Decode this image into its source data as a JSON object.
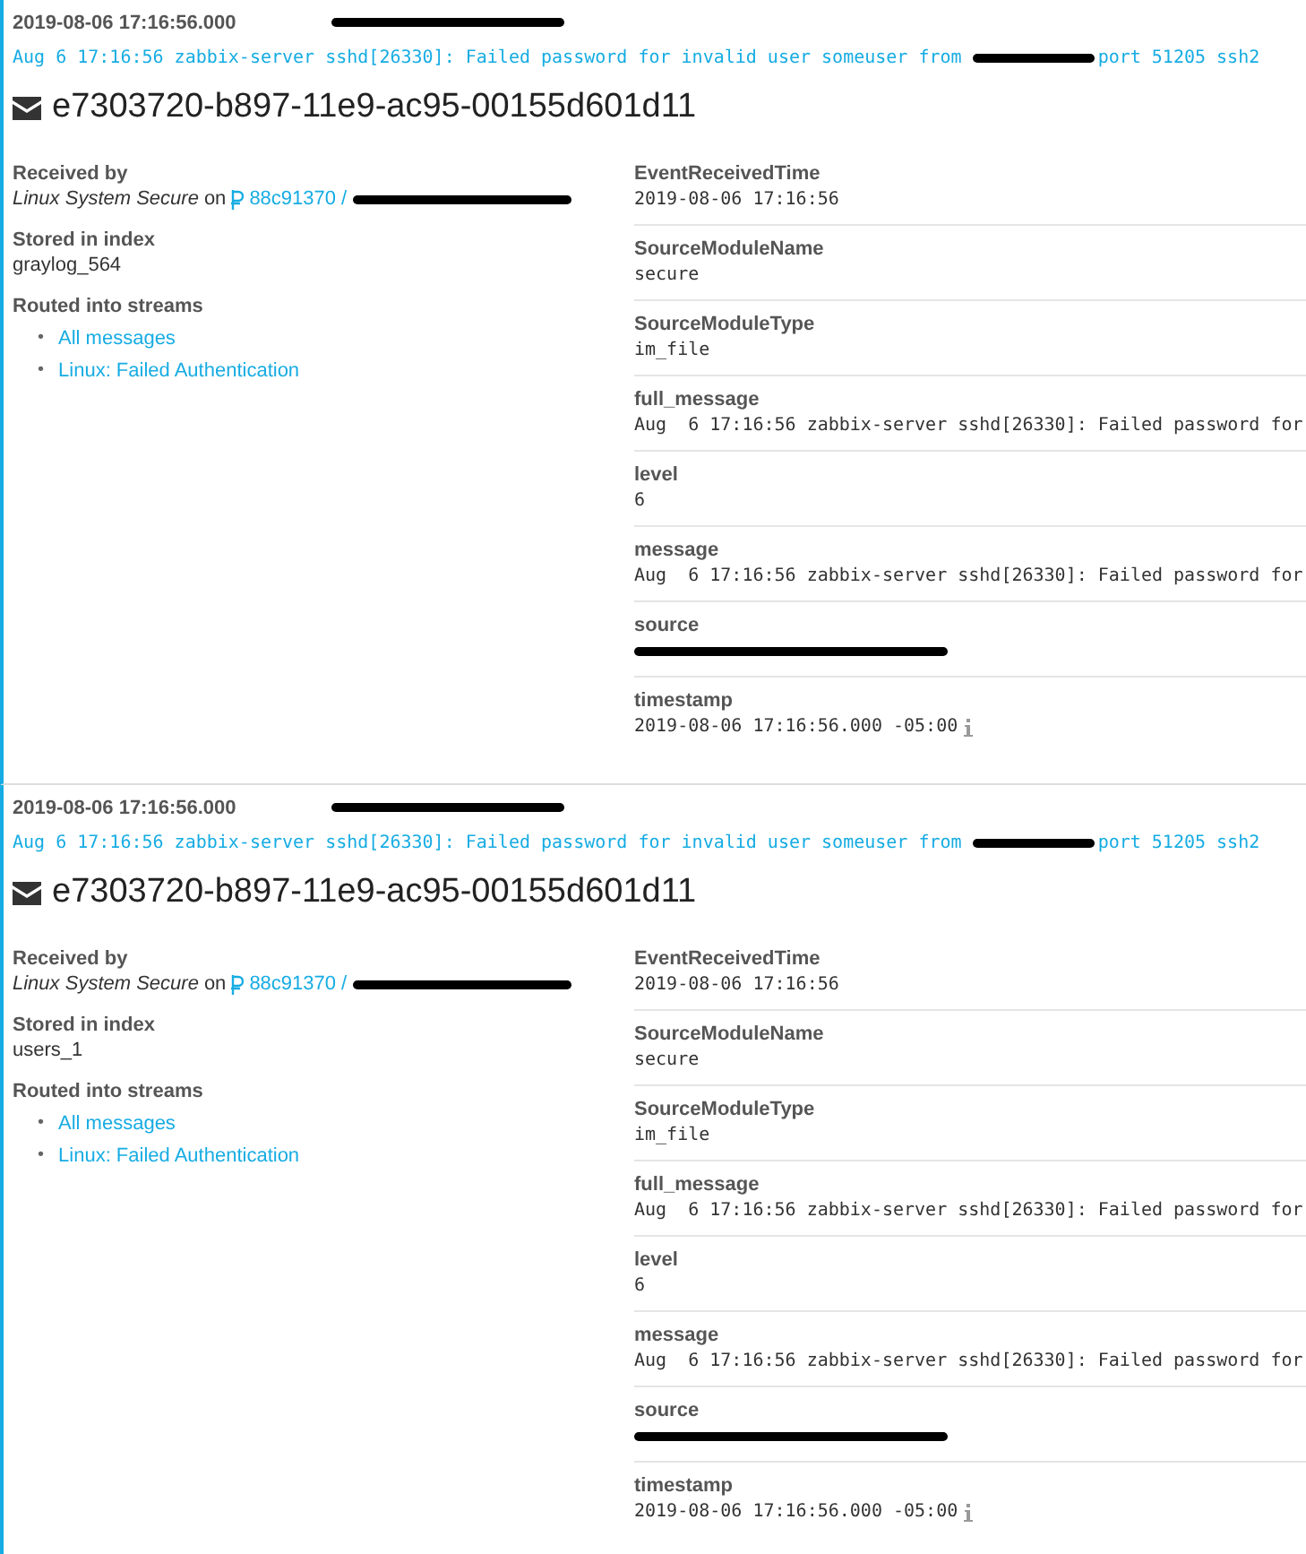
{
  "messages": [
    {
      "timestamp": "2019-08-06 17:16:56.000",
      "log_line": {
        "before": "Aug 6 17:16:56 zabbix-server sshd[26330]: Failed password for invalid user someuser from",
        "after": "port 51205 ssh2"
      },
      "message_id": "e7303720-b897-11e9-ac95-00155d601d11",
      "received_by": {
        "label": "Received by",
        "input": "Linux System Secure",
        "on": "on",
        "node": "88c91370",
        "separator": "/"
      },
      "stored": {
        "label": "Stored in index",
        "value": "graylog_564"
      },
      "streams": {
        "label": "Routed into streams",
        "items": [
          {
            "marker": "•",
            "label": "All messages"
          },
          {
            "marker": "•",
            "label": "Linux: Failed Authentication"
          }
        ]
      },
      "fields": [
        {
          "kind": "text",
          "name": "EventReceivedTime",
          "value": "2019-08-06 17:16:56"
        },
        {
          "kind": "text",
          "name": "SourceModuleName",
          "value": "secure"
        },
        {
          "kind": "text",
          "name": "SourceModuleType",
          "value": "im_file"
        },
        {
          "kind": "text",
          "name": "full_message",
          "value": "Aug  6 17:16:56 zabbix-server sshd[26330]: Failed password for"
        },
        {
          "kind": "text",
          "name": "level",
          "value": "6"
        },
        {
          "kind": "text",
          "name": "message",
          "value": "Aug  6 17:16:56 zabbix-server sshd[26330]: Failed password for"
        },
        {
          "kind": "redacted",
          "name": "source"
        },
        {
          "kind": "timestamp",
          "name": "timestamp",
          "value": "2019-08-06 17:16:56.000 -05:00"
        }
      ]
    },
    {
      "timestamp": "2019-08-06 17:16:56.000",
      "log_line": {
        "before": "Aug 6 17:16:56 zabbix-server sshd[26330]: Failed password for invalid user someuser from",
        "after": "port 51205 ssh2"
      },
      "message_id": "e7303720-b897-11e9-ac95-00155d601d11",
      "received_by": {
        "label": "Received by",
        "input": "Linux System Secure",
        "on": "on",
        "node": "88c91370",
        "separator": "/"
      },
      "stored": {
        "label": "Stored in index",
        "value": "users_1"
      },
      "streams": {
        "label": "Routed into streams",
        "items": [
          {
            "marker": "•",
            "label": "All messages"
          },
          {
            "marker": "•",
            "label": "Linux: Failed Authentication"
          }
        ]
      },
      "fields": [
        {
          "kind": "text",
          "name": "EventReceivedTime",
          "value": "2019-08-06 17:16:56"
        },
        {
          "kind": "text",
          "name": "SourceModuleName",
          "value": "secure"
        },
        {
          "kind": "text",
          "name": "SourceModuleType",
          "value": "im_file"
        },
        {
          "kind": "text",
          "name": "full_message",
          "value": "Aug  6 17:16:56 zabbix-server sshd[26330]: Failed password for"
        },
        {
          "kind": "text",
          "name": "level",
          "value": "6"
        },
        {
          "kind": "text",
          "name": "message",
          "value": "Aug  6 17:16:56 zabbix-server sshd[26330]: Failed password for"
        },
        {
          "kind": "redacted",
          "name": "source"
        },
        {
          "kind": "timestamp",
          "name": "timestamp",
          "value": "2019-08-06 17:16:56.000 -05:00"
        }
      ]
    }
  ]
}
